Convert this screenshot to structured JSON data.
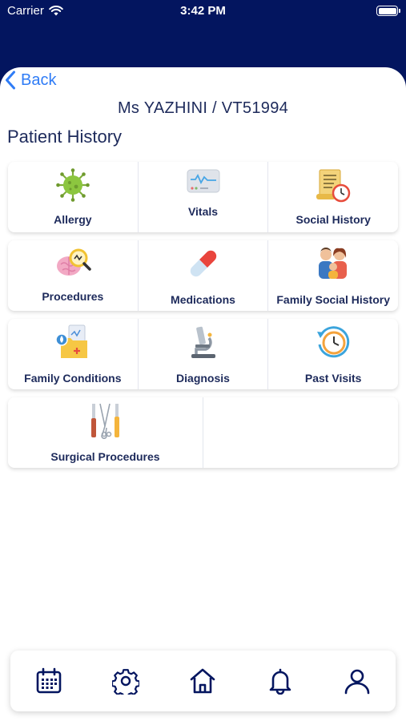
{
  "status_bar": {
    "carrier": "Carrier",
    "time": "3:42 PM"
  },
  "header": {
    "back_label": "Back",
    "patient": "Ms YAZHINI / VT51994",
    "title": "Patient History"
  },
  "tiles": [
    {
      "label": "Allergy",
      "icon": "allergy-virus-icon"
    },
    {
      "label": "Vitals",
      "icon": "vitals-monitor-icon"
    },
    {
      "label": "Social History",
      "icon": "social-history-scroll-icon"
    },
    {
      "label": "Procedures",
      "icon": "procedures-brain-icon"
    },
    {
      "label": "Medications",
      "icon": "medications-pill-icon"
    },
    {
      "label": "Family Social History",
      "icon": "family-icon"
    },
    {
      "label": "Family Conditions",
      "icon": "family-conditions-folder-icon"
    },
    {
      "label": "Diagnosis",
      "icon": "microscope-icon"
    },
    {
      "label": "Past Visits",
      "icon": "past-visits-clock-icon"
    },
    {
      "label": "Surgical Procedures",
      "icon": "surgical-tools-icon"
    }
  ],
  "tab_bar": [
    {
      "name": "calendar-icon"
    },
    {
      "name": "settings-gear-icon"
    },
    {
      "name": "home-icon"
    },
    {
      "name": "notifications-bell-icon"
    },
    {
      "name": "profile-icon"
    }
  ],
  "colors": {
    "header_bg": "#03155f",
    "accent": "#2f7cf6",
    "text": "#1d2a5b"
  }
}
